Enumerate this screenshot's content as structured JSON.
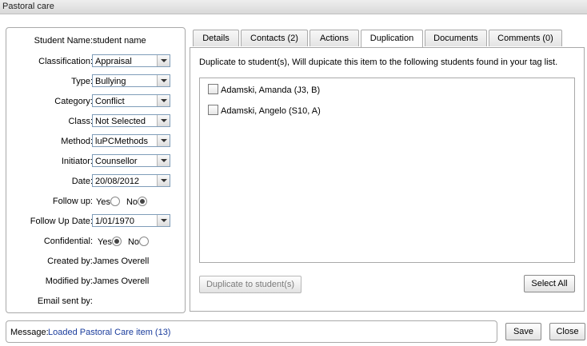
{
  "window": {
    "title": "Pastoral care"
  },
  "form": {
    "student_name": {
      "label": "Student Name:",
      "value": "student name"
    },
    "classification": {
      "label": "Classification:",
      "value": "Appraisal"
    },
    "type": {
      "label": "Type:",
      "value": "Bullying"
    },
    "category": {
      "label": "Category:",
      "value": "Conflict"
    },
    "class": {
      "label": "Class:",
      "value": "Not Selected"
    },
    "method": {
      "label": "Method:",
      "value": "luPCMethods"
    },
    "initiator": {
      "label": "Initiator:",
      "value": "Counsellor"
    },
    "date": {
      "label": "Date:",
      "value": "20/08/2012"
    },
    "follow_up": {
      "label": "Follow up:",
      "yes": "Yes",
      "no": "No",
      "selected": "No"
    },
    "follow_up_date": {
      "label": "Follow Up Date:",
      "value": "1/01/1970"
    },
    "confidential": {
      "label": "Confidential:",
      "yes": "Yes",
      "no": "No",
      "selected": "Yes"
    },
    "created_by": {
      "label": "Created by:",
      "value": "James Overell"
    },
    "modified_by": {
      "label": "Modified by:",
      "value": "James Overell"
    },
    "email_sent_by": {
      "label": "Email sent by:",
      "value": ""
    }
  },
  "tabs": [
    {
      "label": "Details"
    },
    {
      "label": "Contacts (2)"
    },
    {
      "label": "Actions"
    },
    {
      "label": "Duplication",
      "active": true
    },
    {
      "label": "Documents"
    },
    {
      "label": "Comments (0)"
    }
  ],
  "duplication": {
    "description": "Duplicate to student(s), Will dupicate this item to the following students found in your tag list.",
    "students": [
      {
        "name": "Adamski, Amanda (J3, B)",
        "checked": false
      },
      {
        "name": "Adamski, Angelo (S10, A)",
        "checked": false
      }
    ],
    "duplicate_button": "Duplicate to student(s)",
    "select_all_button": "Select All"
  },
  "message": {
    "label": "Message:",
    "text": "Loaded Pastoral Care item (13)"
  },
  "footer": {
    "save_label": "Save",
    "close_label": "Close"
  }
}
